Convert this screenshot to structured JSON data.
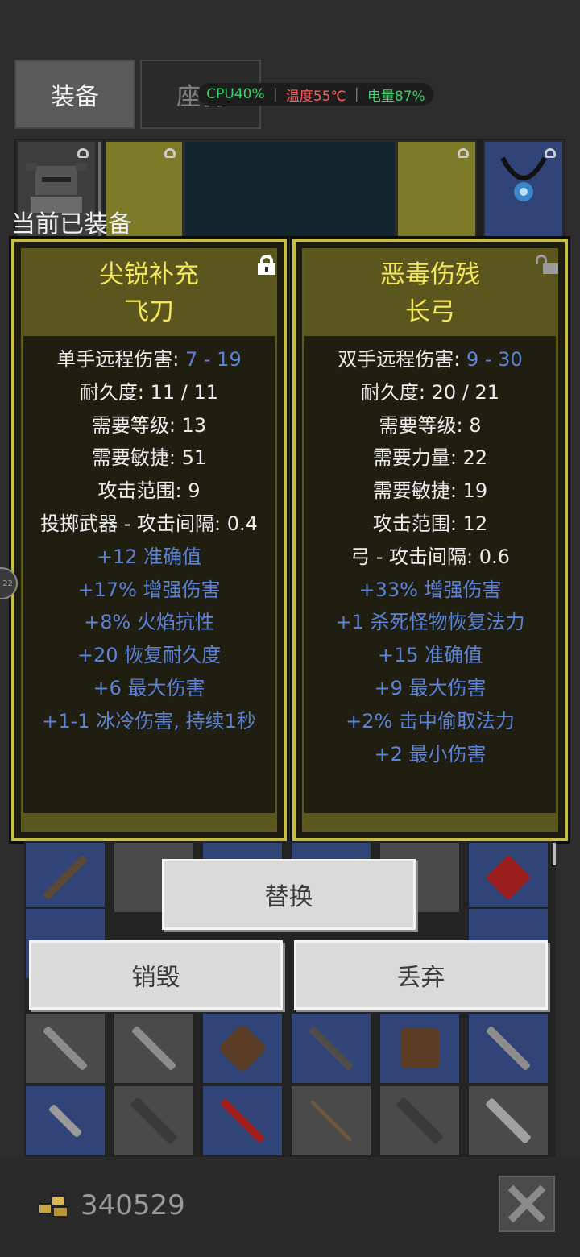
{
  "tabs": {
    "active": "装备",
    "inactive": "座骑"
  },
  "status": {
    "cpu": "CPU40%",
    "temp": "温度55℃",
    "battery": "电量87%",
    "cpu_color": "#39d46b",
    "temp_color": "#ff5a5a",
    "battery_color": "#39d46b"
  },
  "equipped_label": "当前已装备",
  "left_item": {
    "name": "尖锐补充",
    "type": "飞刀",
    "lock_icon": "lock-closed-icon",
    "stats": [
      {
        "text": "单手远程伤害: ",
        "value": "7 - 19"
      },
      {
        "text": "耐久度: 11 / 11"
      },
      {
        "text": "需要等级: 13"
      },
      {
        "text": "需要敏捷: 51"
      },
      {
        "text": "攻击范围: 9"
      },
      {
        "text": "投掷武器 - 攻击间隔: 0.4"
      }
    ],
    "bonuses": [
      "+12 准确值",
      "+17% 增强伤害",
      "+8% 火焰抗性",
      "+20 恢复耐久度",
      "+6 最大伤害",
      "+1-1 冰冷伤害, 持续1秒"
    ]
  },
  "right_item": {
    "name": "恶毒伤残",
    "type": "长弓",
    "lock_icon": "lock-open-icon",
    "stats": [
      {
        "text": "双手远程伤害: ",
        "value": "9 - 30"
      },
      {
        "text": "耐久度: 20 / 21"
      },
      {
        "text": "需要等级: 8"
      },
      {
        "text": "需要力量: 22"
      },
      {
        "text": "需要敏捷: 19"
      },
      {
        "text": "攻击范围: 12"
      },
      {
        "text": "弓 - 攻击间隔: 0.6"
      }
    ],
    "bonuses": [
      "+33% 增强伤害",
      "+1 杀死怪物恢复法力",
      "+15 准确值",
      "+9 最大伤害",
      "+2% 击中偷取法力",
      "+2 最小伤害"
    ]
  },
  "buttons": {
    "replace": "替换",
    "destroy": "销毁",
    "drop": "丢弃"
  },
  "gold": {
    "amount": "340529",
    "icon": "gold-coins-icon"
  },
  "close_icon": "close-icon",
  "side_bubble": "22",
  "colors": {
    "card_border": "#c7bd45",
    "card_title": "#f4e75b",
    "bonus_blue": "#5b83d8"
  }
}
